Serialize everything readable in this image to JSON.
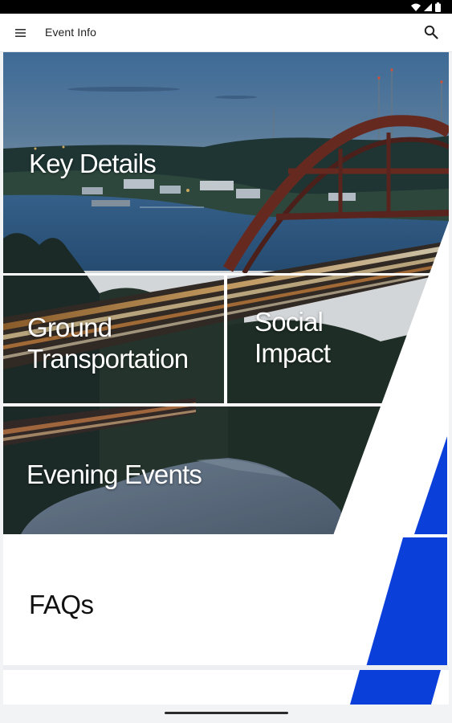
{
  "app_bar": {
    "title": "Event Info",
    "menu_icon": "menu-icon",
    "search_icon": "search-icon"
  },
  "status_bar": {
    "icons": [
      "wifi-icon",
      "signal-icon",
      "battery-icon"
    ]
  },
  "tiles": {
    "key_details": "Key Details",
    "ground_transportation_line1": "Ground",
    "ground_transportation_line2": "Transportation",
    "social_impact_line1": "Social",
    "social_impact_line2": "Impact",
    "evening_events": "Evening Events",
    "faqs": "FAQs"
  },
  "colors": {
    "accent_blue": "#0a3fd9",
    "app_bar_bg": "#ffffff",
    "page_bg": "#f2f3f5"
  }
}
